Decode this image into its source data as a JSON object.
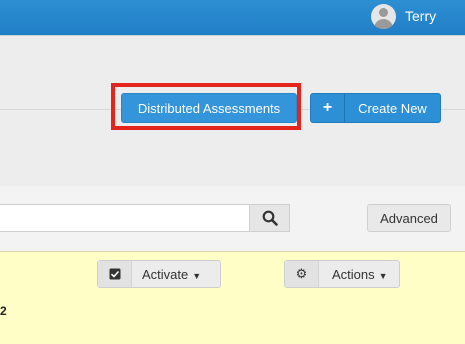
{
  "topbar": {
    "username": "Terry",
    "avatar_icon": "user-avatar-icon"
  },
  "toolbar": {
    "distributed_label": "Distributed Assessments",
    "create_icon": "plus-icon",
    "create_label": "Create New"
  },
  "search": {
    "placeholder": "",
    "icon": "search-icon",
    "advanced_label": "Advanced"
  },
  "panel": {
    "activate_icon": "checkbox-icon",
    "activate_label": "Activate",
    "actions_icon": "gear-icon",
    "actions_label": "Actions",
    "partial_text": "2"
  },
  "colors": {
    "highlight": "#e4251c",
    "primary": "#3495db"
  }
}
